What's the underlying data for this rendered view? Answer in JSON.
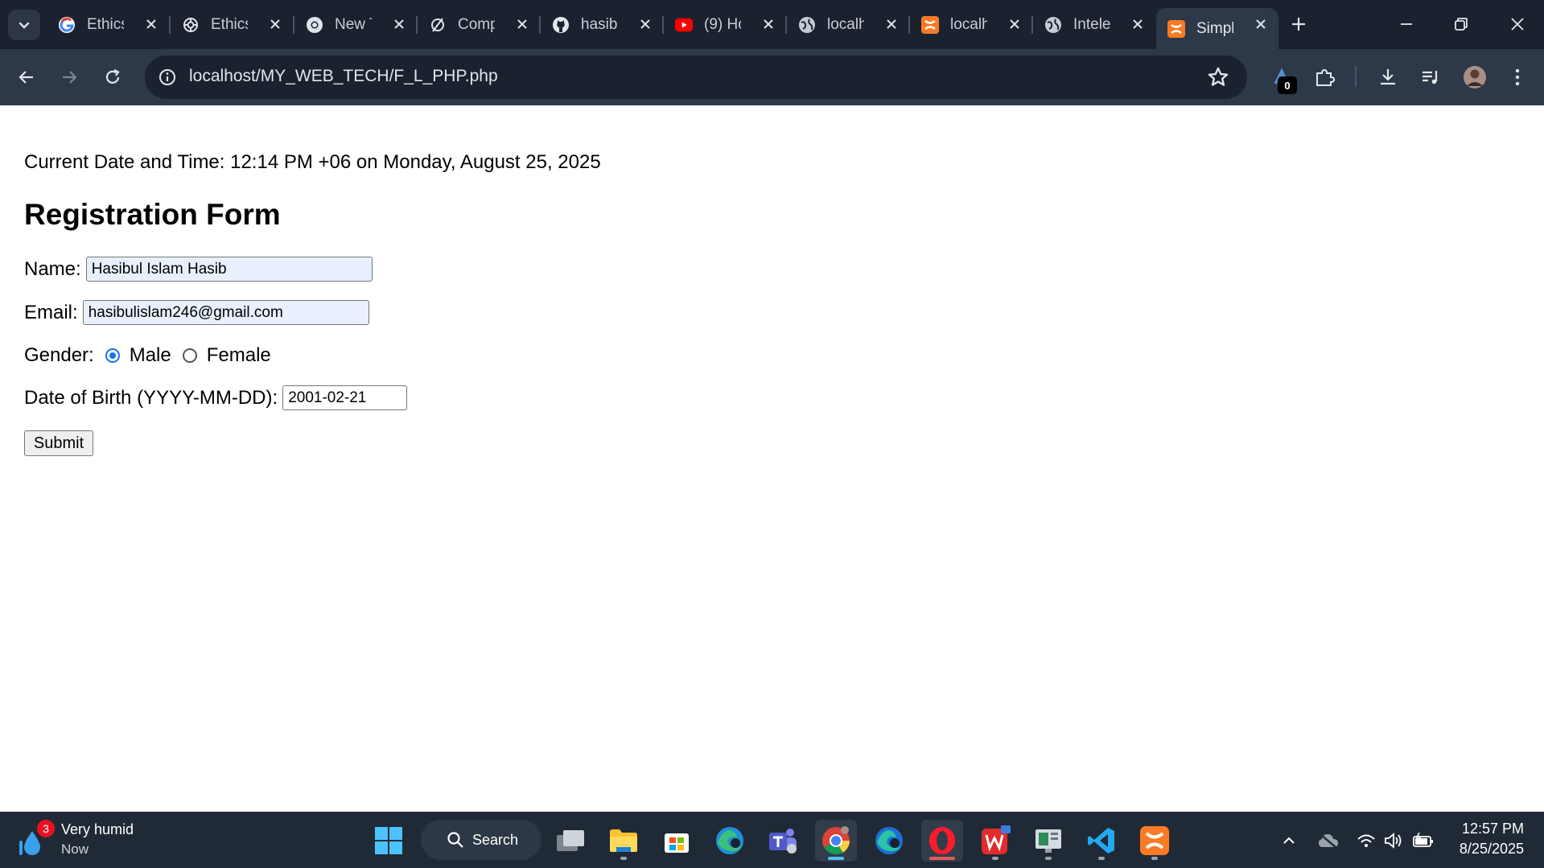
{
  "browser": {
    "tabs": [
      {
        "title": "Ethics",
        "icon": "google-icon"
      },
      {
        "title": "Ethics",
        "icon": "chatgpt-icon"
      },
      {
        "title": "New T",
        "icon": "chrome-icon"
      },
      {
        "title": "Comp",
        "icon": "perplexity-icon"
      },
      {
        "title": "hasib",
        "icon": "github-icon"
      },
      {
        "title": "(9) Ho",
        "icon": "youtube-icon"
      },
      {
        "title": "localh",
        "icon": "globe-icon"
      },
      {
        "title": "localh",
        "icon": "xampp-icon"
      },
      {
        "title": "Intele",
        "icon": "globe-icon"
      },
      {
        "title": "Simpl",
        "icon": "xampp-icon",
        "active": true
      }
    ],
    "url": "localhost/MY_WEB_TECH/F_L_PHP.php",
    "extension_badge": "0"
  },
  "page": {
    "datetime_text": "Current Date and Time: 12:14 PM +06 on Monday, August 25, 2025",
    "form_title": "Registration Form",
    "name_label": "Name:",
    "name_value": "Hasibul Islam Hasib",
    "email_label": "Email:",
    "email_value": "hasibulislam246@gmail.com",
    "gender_label": "Gender:",
    "gender_options": [
      "Male",
      "Female"
    ],
    "gender_selected": "Male",
    "dob_label": "Date of Birth (YYYY-MM-DD):",
    "dob_value": "2001-02-21",
    "submit_label": "Submit"
  },
  "taskbar": {
    "weather_badge": "3",
    "weather_main": "Very humid",
    "weather_sub": "Now",
    "search_label": "Search",
    "time": "12:57 PM",
    "date": "8/25/2025"
  },
  "colors": {
    "tabstrip_bg": "#1a2230",
    "toolbar_bg": "#2d3848",
    "autofill_bg": "#e8f0fe",
    "radio_accent": "#1a73e8",
    "taskbar_bg": "#202a36"
  }
}
